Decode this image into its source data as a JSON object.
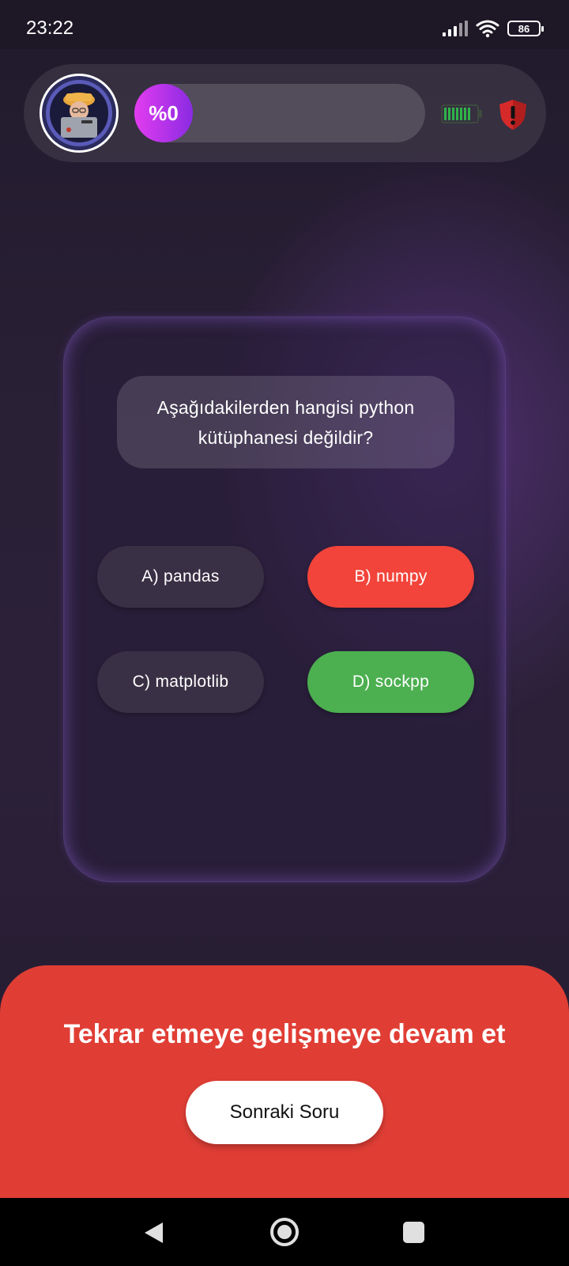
{
  "status_bar": {
    "time": "23:22",
    "battery_percent": "86",
    "icons": [
      "signal-icon",
      "wifi-icon",
      "battery-icon"
    ]
  },
  "header": {
    "avatar": "avatar-memoji",
    "progress": {
      "label": "%0",
      "value": 0
    },
    "energy_icon": "battery-full-icon",
    "shield_icon": "shield-alert-icon"
  },
  "quiz": {
    "question": "Aşağıdakilerden hangisi python kütüphanesi değildir?",
    "answers": [
      {
        "label": "A) pandas",
        "state": "neutral",
        "color": "#3a3045"
      },
      {
        "label": "B) numpy",
        "state": "wrong",
        "color": "#f2443a"
      },
      {
        "label": "C) matplotlib",
        "state": "neutral",
        "color": "#3a3045"
      },
      {
        "label": "D) sockpp",
        "state": "correct",
        "color": "#4caf50"
      }
    ]
  },
  "feedback": {
    "message": "Tekrar etmeye gelişmeye devam et",
    "next_button": "Sonraki Soru",
    "color": "#e03e35"
  },
  "nav": {
    "icons": [
      "back-icon",
      "home-icon",
      "recents-icon"
    ]
  }
}
